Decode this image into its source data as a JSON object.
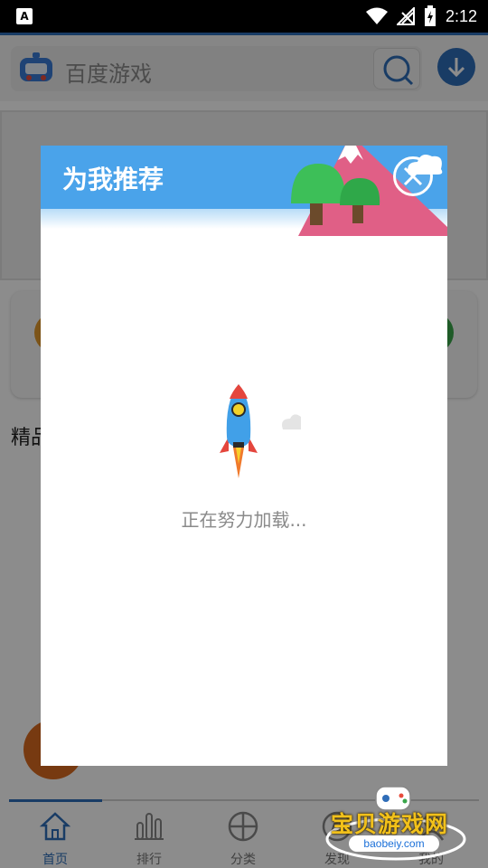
{
  "status_bar": {
    "time": "2:12",
    "notification_glyph": "A"
  },
  "header": {
    "search_placeholder": "百度游戏",
    "accent_color": "#2f6db8"
  },
  "background": {
    "section_title": "精品"
  },
  "bottom_nav": {
    "items": [
      {
        "label": "首页",
        "icon": "home-icon",
        "active": true
      },
      {
        "label": "排行",
        "icon": "ranking-icon",
        "active": false
      },
      {
        "label": "分类",
        "icon": "category-icon",
        "active": false
      },
      {
        "label": "发现",
        "icon": "discover-icon",
        "active": false
      },
      {
        "label": "我的",
        "icon": "profile-icon",
        "active": false
      }
    ]
  },
  "modal": {
    "title": "为我推荐",
    "loading_text": "正在努力加载...",
    "header_color": "#4aa3ea"
  },
  "watermark": {
    "title": "宝贝游戏网",
    "url": "baobeiy.com"
  }
}
